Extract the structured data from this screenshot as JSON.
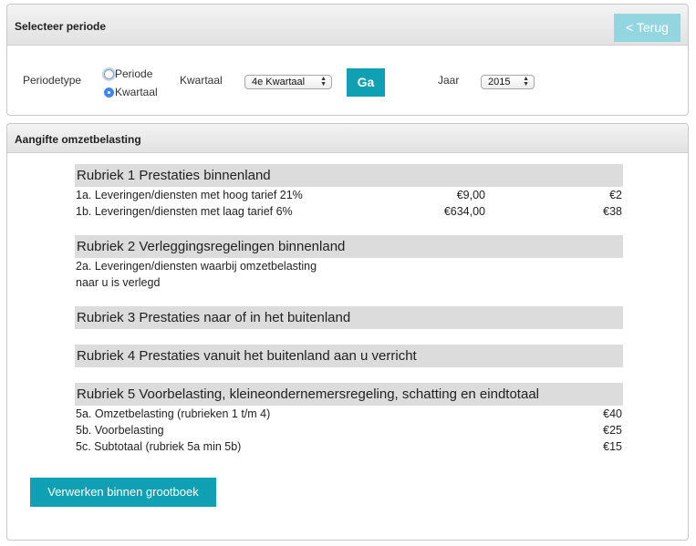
{
  "period_panel": {
    "title": "Selecteer periode",
    "back_label": "< Terug",
    "periodetype_label": "Periodetype",
    "radio_periode": "Periode",
    "radio_kwartaal": "Kwartaal",
    "selected_type": "Kwartaal",
    "kwartaal_label": "Kwartaal",
    "kwartaal_value": "4e Kwartaal",
    "go_label": "Ga",
    "jaar_label": "Jaar",
    "jaar_value": "2015"
  },
  "vat_panel": {
    "title": "Aangifte omzetbelasting",
    "r1": {
      "title": "Rubriek 1 Prestaties binnenland",
      "rows": [
        {
          "label": "1a. Leveringen/diensten met hoog tarief 21%",
          "amount": "€9,00",
          "tax": "€2"
        },
        {
          "label": "1b. Leveringen/diensten met laag tarief 6%",
          "amount": "€634,00",
          "tax": "€38"
        }
      ]
    },
    "r2": {
      "title": "Rubriek 2 Verleggingsregelingen binnenland",
      "line1": "2a. Leveringen/diensten waarbij omzetbelasting",
      "line2": "naar u is verlegd"
    },
    "r3": {
      "title": "Rubriek 3 Prestaties naar of in het buitenland"
    },
    "r4": {
      "title": "Rubriek 4 Prestaties vanuit het buitenland aan u verricht"
    },
    "r5": {
      "title": "Rubriek 5 Voorbelasting, kleineondernemersregeling, schatting en eindtotaal",
      "rows": [
        {
          "label": "5a. Omzetbelasting (rubrieken 1 t/m 4)",
          "tax": "€40"
        },
        {
          "label": "5b. Voorbelasting",
          "tax": "€25"
        },
        {
          "label": "5c. Subtotaal (rubriek 5a min 5b)",
          "tax": "€15"
        }
      ]
    },
    "process_label": "Verwerken binnen grootboek"
  },
  "colors": {
    "accent": "#0fa0b4",
    "accent_light": "#93d6e0",
    "section_bg": "#dcdcdc",
    "radio_selected": "#3b89f0"
  }
}
